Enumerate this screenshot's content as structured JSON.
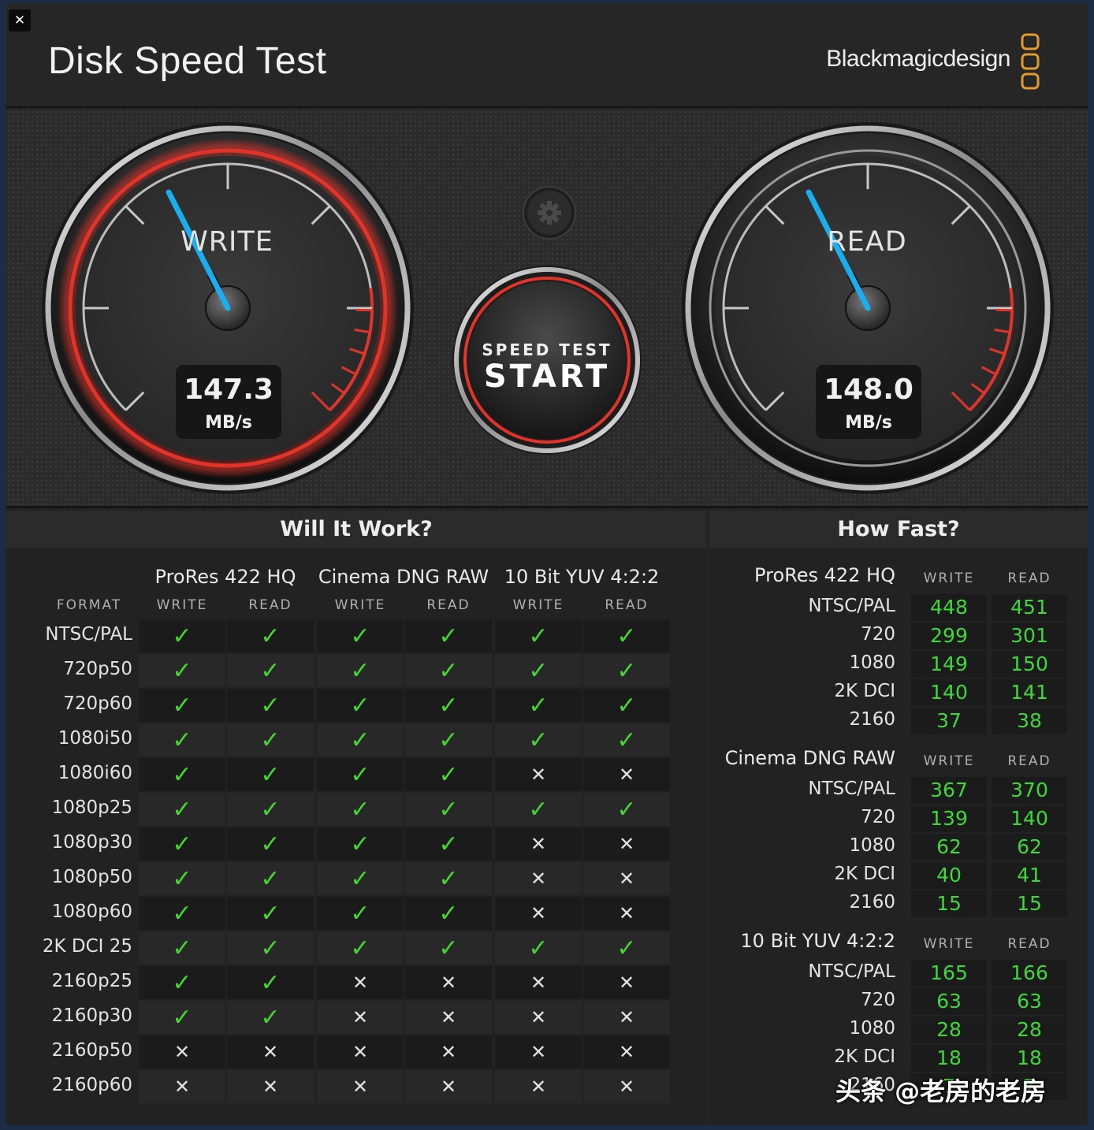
{
  "window": {
    "title": "Disk Speed Test",
    "brand": "Blackmagicdesign",
    "close_icon": "close-icon"
  },
  "colors": {
    "accent_red": "#e0342a",
    "needle_blue": "#19aeef",
    "ok_green": "#46d633",
    "value_green": "#3fd83a"
  },
  "write_gauge": {
    "label": "WRITE",
    "value": "147.3",
    "unit": "MB/s",
    "needle_fraction": 0.4
  },
  "read_gauge": {
    "label": "READ",
    "value": "148.0",
    "unit": "MB/s",
    "needle_fraction": 0.4
  },
  "start_button": {
    "line1": "SPEED TEST",
    "line2": "START"
  },
  "settings_icon": "gear-icon",
  "will_it_work": {
    "title": "Will It Work?",
    "format_header": "FORMAT",
    "groups": [
      "ProRes 422 HQ",
      "Cinema DNG RAW",
      "10 Bit YUV 4:2:2"
    ],
    "sub_headers": [
      "WRITE",
      "READ"
    ],
    "rows": [
      {
        "format": "NTSC/PAL",
        "results": [
          1,
          1,
          1,
          1,
          1,
          1
        ]
      },
      {
        "format": "720p50",
        "results": [
          1,
          1,
          1,
          1,
          1,
          1
        ]
      },
      {
        "format": "720p60",
        "results": [
          1,
          1,
          1,
          1,
          1,
          1
        ]
      },
      {
        "format": "1080i50",
        "results": [
          1,
          1,
          1,
          1,
          1,
          1
        ]
      },
      {
        "format": "1080i60",
        "results": [
          1,
          1,
          1,
          1,
          0,
          0
        ]
      },
      {
        "format": "1080p25",
        "results": [
          1,
          1,
          1,
          1,
          1,
          1
        ]
      },
      {
        "format": "1080p30",
        "results": [
          1,
          1,
          1,
          1,
          0,
          0
        ]
      },
      {
        "format": "1080p50",
        "results": [
          1,
          1,
          1,
          1,
          0,
          0
        ]
      },
      {
        "format": "1080p60",
        "results": [
          1,
          1,
          1,
          1,
          0,
          0
        ]
      },
      {
        "format": "2K DCI 25",
        "results": [
          1,
          1,
          1,
          1,
          1,
          1
        ]
      },
      {
        "format": "2160p25",
        "results": [
          1,
          1,
          0,
          0,
          0,
          0
        ]
      },
      {
        "format": "2160p30",
        "results": [
          1,
          1,
          0,
          0,
          0,
          0
        ]
      },
      {
        "format": "2160p50",
        "results": [
          0,
          0,
          0,
          0,
          0,
          0
        ]
      },
      {
        "format": "2160p60",
        "results": [
          0,
          0,
          0,
          0,
          0,
          0
        ]
      }
    ],
    "ok_glyph": "✓",
    "fail_glyph": "✕"
  },
  "how_fast": {
    "title": "How Fast?",
    "sub_headers": [
      "WRITE",
      "READ"
    ],
    "groups": [
      {
        "name": "ProRes 422 HQ",
        "rows": [
          {
            "format": "NTSC/PAL",
            "write": "448",
            "read": "451"
          },
          {
            "format": "720",
            "write": "299",
            "read": "301"
          },
          {
            "format": "1080",
            "write": "149",
            "read": "150"
          },
          {
            "format": "2K DCI",
            "write": "140",
            "read": "141"
          },
          {
            "format": "2160",
            "write": "37",
            "read": "38"
          }
        ]
      },
      {
        "name": "Cinema DNG RAW",
        "rows": [
          {
            "format": "NTSC/PAL",
            "write": "367",
            "read": "370"
          },
          {
            "format": "720",
            "write": "139",
            "read": "140"
          },
          {
            "format": "1080",
            "write": "62",
            "read": "62"
          },
          {
            "format": "2K DCI",
            "write": "40",
            "read": "41"
          },
          {
            "format": "2160",
            "write": "15",
            "read": "15"
          }
        ]
      },
      {
        "name": "10 Bit YUV 4:2:2",
        "rows": [
          {
            "format": "NTSC/PAL",
            "write": "165",
            "read": "166"
          },
          {
            "format": "720",
            "write": "63",
            "read": "63"
          },
          {
            "format": "1080",
            "write": "28",
            "read": "28"
          },
          {
            "format": "2K DCI",
            "write": "18",
            "read": "18"
          },
          {
            "format": "2160",
            "write": "7",
            "read": "7"
          }
        ]
      }
    ]
  },
  "watermark": "头条 @老房的老房"
}
